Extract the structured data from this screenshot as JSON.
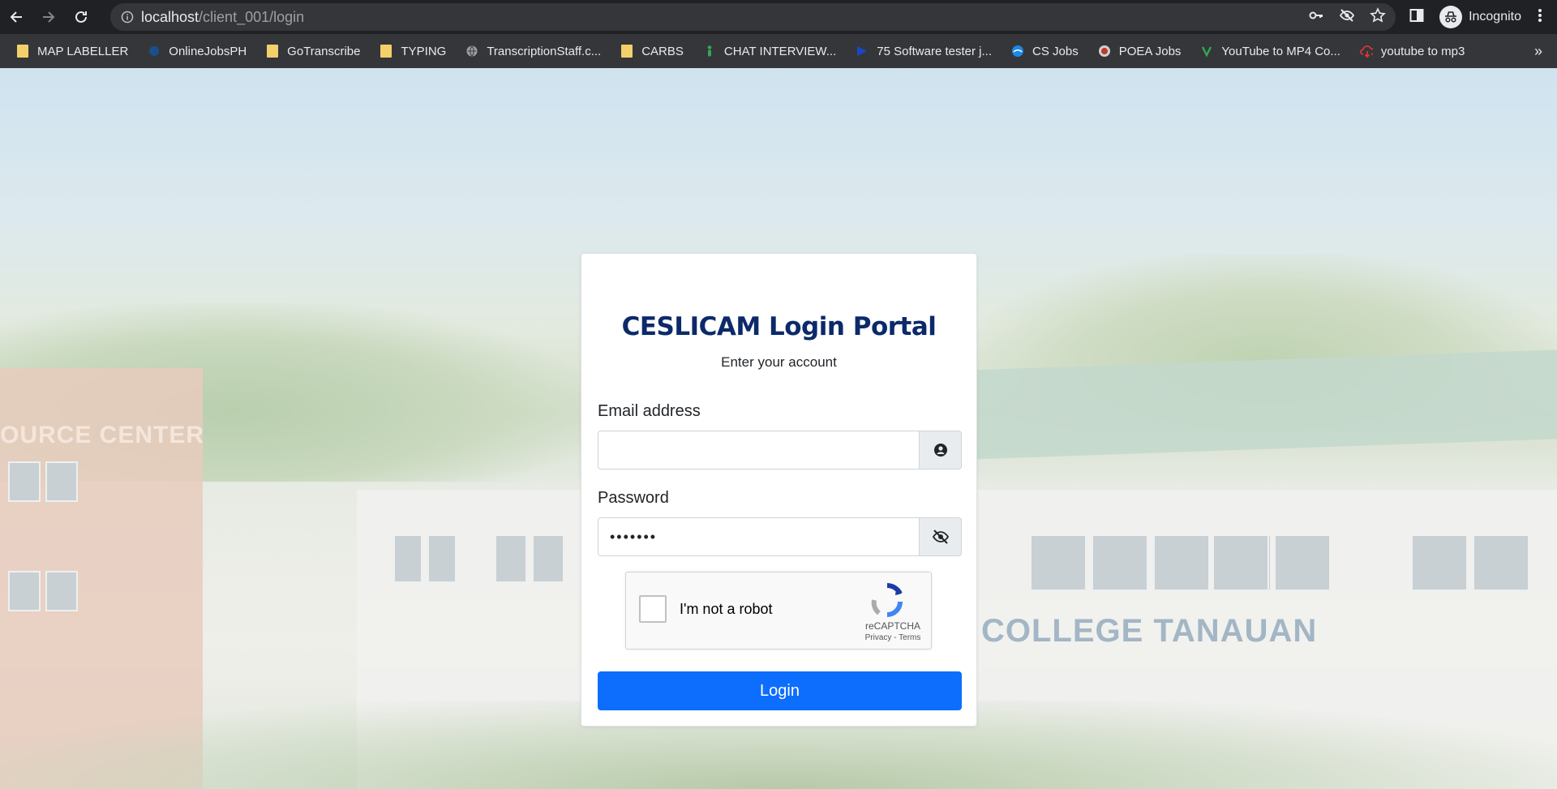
{
  "browser": {
    "url_host": "localhost",
    "url_path": "/client_001/login",
    "profile_label": "Incognito",
    "bookmarks": [
      {
        "label": "MAP LABELLER",
        "icon": "folder-icon"
      },
      {
        "label": "OnlineJobsPH",
        "icon": "onlinejobsph-icon"
      },
      {
        "label": "GoTranscribe",
        "icon": "folder-icon"
      },
      {
        "label": "TYPING",
        "icon": "folder-icon"
      },
      {
        "label": "TranscriptionStaff.c...",
        "icon": "globe-icon"
      },
      {
        "label": "CARBS",
        "icon": "folder-icon"
      },
      {
        "label": "CHAT INTERVIEW...",
        "icon": "person-icon"
      },
      {
        "label": "75 Software tester j...",
        "icon": "flag-icon"
      },
      {
        "label": "CS Jobs",
        "icon": "cs-jobs-icon"
      },
      {
        "label": "POEA Jobs",
        "icon": "poea-icon"
      },
      {
        "label": "YouTube to MP4 Co...",
        "icon": "download-icon"
      },
      {
        "label": "youtube to mp3",
        "icon": "cloud-download-icon"
      }
    ],
    "more_label": "»"
  },
  "background": {
    "tower_sign": "OURCE CENTER",
    "building_sign": "COLLEGE TANAUAN"
  },
  "login": {
    "title": "CESLICAM Login Portal",
    "subtitle": "Enter your account",
    "email_label": "Email address",
    "email_value": "",
    "password_label": "Password",
    "password_value": "•••••••",
    "captcha_text": "I'm not a robot",
    "captcha_brand": "reCAPTCHA",
    "captcha_links": "Privacy - Terms",
    "login_button": "Login"
  },
  "colors": {
    "title": "#0c2a6a",
    "primary_button": "#0d6efd",
    "chrome_dark": "#202124",
    "bookmarks_bar": "#35363a"
  }
}
